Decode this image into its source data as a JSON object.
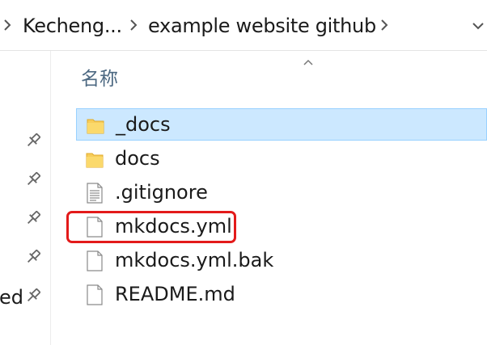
{
  "breadcrumb": {
    "items": [
      {
        "label": "Kecheng..."
      },
      {
        "label": "example website github"
      }
    ]
  },
  "columns": {
    "name_header": "名称",
    "sort_direction": "ascending"
  },
  "nav_pane": {
    "partial_label": "ed",
    "pinned_count": 5
  },
  "files": [
    {
      "name": "_docs",
      "type": "folder",
      "selected": true
    },
    {
      "name": "docs",
      "type": "folder",
      "selected": false
    },
    {
      "name": ".gitignore",
      "type": "text-file",
      "selected": false
    },
    {
      "name": "mkdocs.yml",
      "type": "file",
      "selected": false,
      "highlighted": true
    },
    {
      "name": "mkdocs.yml.bak",
      "type": "file",
      "selected": false
    },
    {
      "name": "README.md",
      "type": "file",
      "selected": false
    }
  ],
  "colors": {
    "selection_fill": "#cce8ff",
    "selection_border": "#99d1ff",
    "annotation_red": "#e31a1a",
    "header_text": "#4d6982",
    "folder_yellow": "#f7cd5a"
  }
}
